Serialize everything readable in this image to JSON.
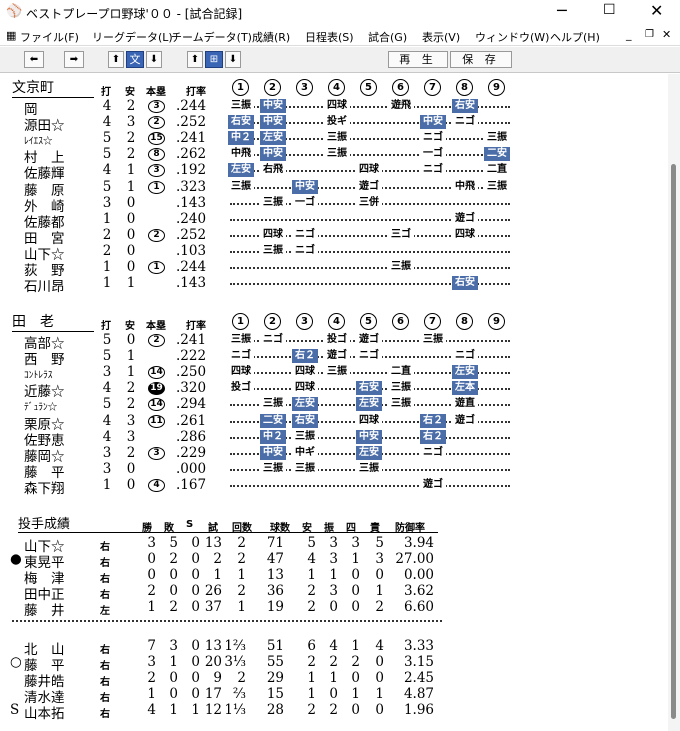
{
  "window": {
    "title": "ベストプレープロ野球'００ - [試合記録]",
    "colors": {
      "hit_bg": "#4c6ea8",
      "toolbar_selected": "#3a64b4"
    }
  },
  "menu": [
    "ファイル(F)",
    "リーグデータ(L)",
    "チームデータ(T)",
    "成績(R)",
    "日程表(S)",
    "試合(G)",
    "表示(V)",
    "ウィンドウ(W)",
    "ヘルプ(H)"
  ],
  "toolbar": {
    "team_label": "文",
    "play_label": "再 生",
    "save_label": "保 存"
  },
  "batting_headers": {
    "ab": "打",
    "h": "安",
    "hr": "本塁",
    "avg": "打率"
  },
  "innings": [
    "①",
    "②",
    "③",
    "④",
    "⑤",
    "⑥",
    "⑦",
    "⑧",
    "⑨"
  ],
  "teams": [
    {
      "name": "文京町",
      "batters": [
        {
          "name": "岡",
          "ab": "4",
          "h": "2",
          "hr": "3",
          "avg": ".244",
          "ev": [
            [
              "三振",
              0
            ],
            [
              "中安",
              1
            ],
            null,
            [
              "四球",
              0
            ],
            null,
            [
              "遊飛",
              0
            ],
            null,
            [
              "右安",
              1
            ],
            null
          ]
        },
        {
          "name": "源田☆",
          "ab": "4",
          "h": "3",
          "hr": "2",
          "avg": ".252",
          "ev": [
            [
              "右安",
              1
            ],
            [
              "中安",
              1
            ],
            null,
            [
              "投ギ",
              0
            ],
            null,
            null,
            [
              "中安",
              1
            ],
            [
              "ニゴ",
              0
            ],
            null
          ]
        },
        {
          "name": "ﾚｲｴｽ☆",
          "small": true,
          "ab": "5",
          "h": "2",
          "hr": "15",
          "avg": ".241",
          "ev": [
            [
              "中２",
              1
            ],
            [
              "左安",
              1
            ],
            null,
            [
              "三振",
              0
            ],
            null,
            null,
            [
              "ニゴ",
              0
            ],
            null,
            [
              "三振",
              0
            ]
          ]
        },
        {
          "name": "村　上",
          "ab": "5",
          "h": "2",
          "hr": "8",
          "avg": ".262",
          "ev": [
            [
              "中飛",
              0
            ],
            [
              "中安",
              1
            ],
            null,
            [
              "三振",
              0
            ],
            null,
            null,
            [
              "一ゴ",
              0
            ],
            null,
            [
              "二安",
              1
            ]
          ]
        },
        {
          "name": "佐藤輝",
          "ab": "4",
          "h": "1",
          "hr": "3",
          "avg": ".192",
          "ev": [
            [
              "左安",
              1
            ],
            [
              "右飛",
              0
            ],
            null,
            null,
            [
              "四球",
              0
            ],
            null,
            [
              "ニゴ",
              0
            ],
            null,
            [
              "二直",
              0
            ]
          ]
        },
        {
          "name": "藤　原",
          "ab": "5",
          "h": "1",
          "hr": "1",
          "avg": ".323",
          "ev": [
            [
              "三振",
              0
            ],
            null,
            [
              "中安",
              1
            ],
            null,
            [
              "遊ゴ",
              0
            ],
            null,
            null,
            [
              "中飛",
              0
            ],
            [
              "三振",
              0
            ]
          ]
        },
        {
          "name": "外　崎",
          "ab": "3",
          "h": "0",
          "hr": "",
          "avg": ".143",
          "ev": [
            null,
            [
              "三振",
              0
            ],
            [
              "一ゴ",
              0
            ],
            null,
            [
              "三併",
              0
            ],
            null,
            null,
            null,
            null
          ]
        },
        {
          "name": "佐藤都",
          "ab": "1",
          "h": "0",
          "hr": "",
          "avg": ".240",
          "ev": [
            null,
            null,
            null,
            null,
            null,
            null,
            null,
            [
              "遊ゴ",
              0
            ],
            null
          ]
        },
        {
          "name": "田　宮",
          "ab": "2",
          "h": "0",
          "hr": "2",
          "avg": ".252",
          "ev": [
            null,
            [
              "四球",
              0
            ],
            [
              "ニゴ",
              0
            ],
            null,
            null,
            [
              "三ゴ",
              0
            ],
            null,
            [
              "四球",
              0
            ],
            null
          ]
        },
        {
          "name": "山下☆",
          "ab": "2",
          "h": "0",
          "hr": "",
          "avg": ".103",
          "ev": [
            null,
            [
              "三振",
              0
            ],
            [
              "ニゴ",
              0
            ],
            null,
            null,
            null,
            null,
            null,
            null
          ]
        },
        {
          "name": "荻　野",
          "ab": "1",
          "h": "0",
          "hr": "1",
          "avg": ".244",
          "ev": [
            null,
            null,
            null,
            null,
            null,
            [
              "三振",
              0
            ],
            null,
            null,
            null
          ]
        },
        {
          "name": "石川昂",
          "ab": "1",
          "h": "1",
          "hr": "",
          "avg": ".143",
          "ev": [
            null,
            null,
            null,
            null,
            null,
            null,
            null,
            [
              "右安",
              1
            ],
            null
          ]
        }
      ]
    },
    {
      "name": "田　老",
      "batters": [
        {
          "name": "高部☆",
          "ab": "5",
          "h": "0",
          "hr": "2",
          "avg": ".241",
          "ev": [
            [
              "三振",
              0
            ],
            [
              "ニゴ",
              0
            ],
            null,
            [
              "投ゴ",
              0
            ],
            [
              "遊ゴ",
              0
            ],
            null,
            [
              "三振",
              0
            ],
            null,
            null
          ]
        },
        {
          "name": "西　野",
          "ab": "5",
          "h": "1",
          "hr": "",
          "avg": ".222",
          "ev": [
            [
              "ニゴ",
              0
            ],
            null,
            [
              "右２",
              1
            ],
            [
              "遊ゴ",
              0
            ],
            [
              "ニゴ",
              0
            ],
            null,
            null,
            [
              "ニゴ",
              0
            ],
            null
          ]
        },
        {
          "name": "ｺﾝﾄﾚﾗｽ",
          "small": true,
          "ab": "3",
          "h": "1",
          "hr": "14",
          "avg": ".250",
          "ev": [
            [
              "四球",
              0
            ],
            null,
            [
              "四球",
              0
            ],
            [
              "三振",
              0
            ],
            null,
            [
              "二直",
              0
            ],
            null,
            [
              "左安",
              1
            ],
            null
          ]
        },
        {
          "name": "近藤☆",
          "ab": "4",
          "h": "2",
          "hr": "19",
          "fill": true,
          "avg": ".320",
          "ev": [
            [
              "投ゴ",
              0
            ],
            null,
            [
              "四球",
              0
            ],
            null,
            [
              "右安",
              1
            ],
            [
              "三振",
              0
            ],
            null,
            [
              "左本",
              1
            ],
            null
          ]
        },
        {
          "name": "ﾃﾞｭﾗﾝ☆",
          "small": true,
          "ab": "5",
          "h": "2",
          "hr": "14",
          "avg": ".294",
          "ev": [
            null,
            [
              "三振",
              0
            ],
            [
              "左安",
              1
            ],
            null,
            [
              "左安",
              1
            ],
            [
              "三振",
              0
            ],
            null,
            [
              "遊直",
              0
            ],
            null
          ]
        },
        {
          "name": "栗原☆",
          "ab": "4",
          "h": "3",
          "hr": "11",
          "avg": ".261",
          "ev": [
            null,
            [
              "二安",
              1
            ],
            [
              "右安",
              1
            ],
            null,
            [
              "四球",
              0
            ],
            null,
            [
              "右２",
              1
            ],
            [
              "遊ゴ",
              0
            ],
            null
          ]
        },
        {
          "name": "佐野恵",
          "ab": "4",
          "h": "3",
          "hr": "",
          "avg": ".286",
          "ev": [
            null,
            [
              "中２",
              1
            ],
            [
              "三振",
              0
            ],
            null,
            [
              "中安",
              1
            ],
            null,
            [
              "右２",
              1
            ],
            null,
            null
          ]
        },
        {
          "name": "藤岡☆",
          "ab": "3",
          "h": "2",
          "hr": "3",
          "avg": ".229",
          "ev": [
            null,
            [
              "中安",
              1
            ],
            [
              "中ギ",
              0
            ],
            null,
            [
              "左安",
              1
            ],
            null,
            [
              "ニゴ",
              0
            ],
            null,
            null
          ]
        },
        {
          "name": "藤　平",
          "ab": "3",
          "h": "0",
          "hr": "",
          "avg": ".000",
          "ev": [
            null,
            [
              "三振",
              0
            ],
            [
              "三振",
              0
            ],
            null,
            [
              "三振",
              0
            ],
            null,
            null,
            null,
            null
          ]
        },
        {
          "name": "森下翔",
          "ab": "1",
          "h": "0",
          "hr": "4",
          "avg": ".167",
          "ev": [
            null,
            null,
            null,
            null,
            null,
            null,
            [
              "遊ゴ",
              0
            ],
            null,
            null
          ]
        }
      ]
    }
  ],
  "pitching": {
    "title": "投手成績",
    "headers": [
      "勝",
      "敗",
      "S",
      "試",
      "回数",
      "球数",
      "安",
      "振",
      "四",
      "責",
      "防御率"
    ],
    "groups": [
      [
        {
          "mark": "",
          "name": "山下☆",
          "hand": "右",
          "w": "3",
          "l": "5",
          "s": "0",
          "g": "13",
          "ip": "2",
          "np": "71",
          "h": "5",
          "k": "3",
          "bb": "3",
          "er": "5",
          "era": "3.94"
        },
        {
          "mark": "●",
          "name": "東晃平",
          "hand": "右",
          "w": "0",
          "l": "2",
          "s": "0",
          "g": "2",
          "ip": "2",
          "np": "47",
          "h": "4",
          "k": "3",
          "bb": "1",
          "er": "3",
          "era": "27.00"
        },
        {
          "mark": "",
          "name": "梅　津",
          "hand": "右",
          "w": "0",
          "l": "0",
          "s": "0",
          "g": "1",
          "ip": "1",
          "np": "13",
          "h": "1",
          "k": "1",
          "bb": "0",
          "er": "0",
          "era": "0.00"
        },
        {
          "mark": "",
          "name": "田中正",
          "hand": "右",
          "w": "2",
          "l": "0",
          "s": "0",
          "g": "26",
          "ip": "2",
          "np": "36",
          "h": "2",
          "k": "3",
          "bb": "0",
          "er": "1",
          "era": "3.62"
        },
        {
          "mark": "",
          "name": "藤　井",
          "hand": "左",
          "w": "1",
          "l": "2",
          "s": "0",
          "g": "37",
          "ip": "1",
          "np": "19",
          "h": "2",
          "k": "0",
          "bb": "0",
          "er": "2",
          "era": "6.60"
        }
      ],
      [
        {
          "mark": "",
          "name": "北　山",
          "hand": "右",
          "w": "7",
          "l": "3",
          "s": "0",
          "g": "13",
          "ip": "1⅔",
          "np": "51",
          "h": "6",
          "k": "4",
          "bb": "1",
          "er": "4",
          "era": "3.33"
        },
        {
          "mark": "○",
          "name": "藤　平",
          "hand": "右",
          "w": "3",
          "l": "1",
          "s": "0",
          "g": "20",
          "ip": "3⅓",
          "np": "55",
          "h": "2",
          "k": "2",
          "bb": "2",
          "er": "0",
          "era": "3.15"
        },
        {
          "mark": "",
          "name": "藤井皓",
          "hand": "右",
          "w": "2",
          "l": "0",
          "s": "0",
          "g": "9",
          "ip": "2",
          "np": "29",
          "h": "1",
          "k": "1",
          "bb": "0",
          "er": "0",
          "era": "2.45"
        },
        {
          "mark": "",
          "name": "清水達",
          "hand": "右",
          "w": "1",
          "l": "0",
          "s": "0",
          "g": "17",
          "ip": "⅔",
          "np": "15",
          "h": "1",
          "k": "0",
          "bb": "1",
          "er": "1",
          "era": "4.87"
        },
        {
          "mark": "S",
          "name": "山本拓",
          "hand": "右",
          "w": "4",
          "l": "1",
          "s": "1",
          "g": "12",
          "ip": "1⅓",
          "np": "28",
          "h": "2",
          "k": "2",
          "bb": "0",
          "er": "0",
          "era": "1.96"
        }
      ]
    ]
  }
}
